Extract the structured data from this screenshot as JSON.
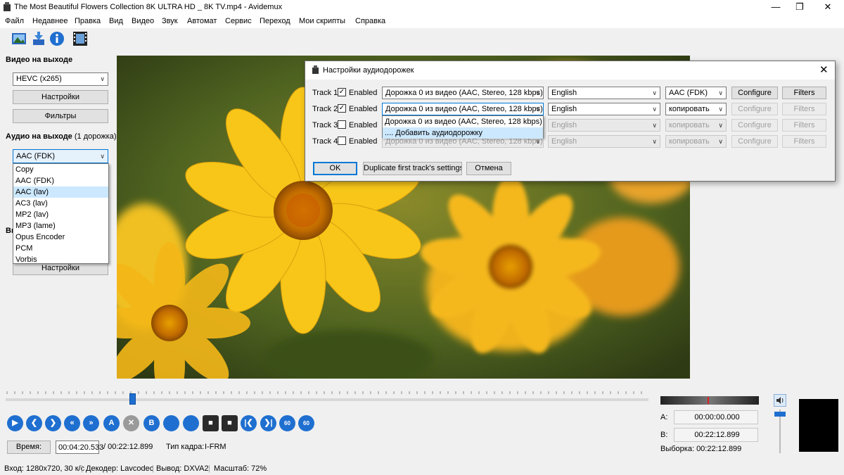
{
  "window": {
    "title": "The Most Beautiful Flowers Collection 8K ULTRA HD _ 8K TV.mp4 - Avidemux",
    "minimize_icon": "minimize-icon",
    "maximize_icon": "restore-icon",
    "close_icon": "close-icon"
  },
  "menu": [
    "Файл",
    "Недавнее",
    "Правка",
    "Вид",
    "Видео",
    "Звук",
    "Автомат",
    "Сервис",
    "Переход",
    "Мои скрипты",
    "Справка"
  ],
  "toolbar": {
    "icons": [
      "open-image-icon",
      "save-icon",
      "info-icon",
      "filmstrip-icon"
    ]
  },
  "left_panel": {
    "video_output_label": "Видео на выходе",
    "video_codec": "HEVC (x265)",
    "settings_label": "Настройки",
    "filters_label": "Фильтры",
    "audio_output_label": "Аудио на выходе",
    "audio_track_count": "(1 дорожка)",
    "audio_codec": "AAC (FDK)",
    "audio_codec_options": [
      "Copy",
      "AAC (FDK)",
      "AAC (lav)",
      "AC3 (lav)",
      "MP2 (lav)",
      "MP3 (lame)",
      "Opus Encoder",
      "PCM",
      "Vorbis"
    ],
    "audio_codec_highlighted": "AAC (lav)",
    "hidden_label_fragment": "Вь",
    "settings2_label": "Настройки"
  },
  "dialog": {
    "title": "Настройки аудиодорожек",
    "enabled_label": "Enabled",
    "tracks": [
      {
        "label": "Track 1",
        "enabled": true,
        "source": "Дорожка 0 из видео (AAC, Stereo, 128 kbps)",
        "language": "English",
        "codec": "AAC (FDK)",
        "configure": "Configure",
        "filters": "Filters",
        "active": true
      },
      {
        "label": "Track 2",
        "enabled": true,
        "source": "Дорожка 0 из видео (AAC, Stereo, 128 kbps)",
        "language": "English",
        "codec": "копировать",
        "configure": "Configure",
        "filters": "Filters",
        "active": false
      },
      {
        "label": "Track 3",
        "enabled": false,
        "source": "Дорожка 0 из видео (AAC, Stereo, 128 kbps)",
        "language": "English",
        "codec": "копировать",
        "configure": "Configure",
        "filters": "Filters",
        "active": false
      },
      {
        "label": "Track 4",
        "enabled": false,
        "source": "Дорожка 0 из видео (AAC, Stereo, 128 kbps)",
        "language": "English",
        "codec": "копировать",
        "configure": "Configure",
        "filters": "Filters",
        "active": false
      }
    ],
    "source_dropdown_options": [
      "Дорожка 0 из видео (AAC, Stereo, 128 kbps)",
      ".... Добавить аудиодорожку"
    ],
    "source_dropdown_highlighted": ".... Добавить аудиодорожку",
    "ok_label": "OK",
    "duplicate_label": "Duplicate first track's settings",
    "cancel_label": "Отмена"
  },
  "playback": {
    "slider_position": 0.197,
    "controls": [
      "play-icon",
      "rewind-icon",
      "forward-icon",
      "prev-frame-icon",
      "next-frame-icon",
      "set-marker-a-icon",
      "clear-markers-icon",
      "set-marker-b-icon",
      "prev-keyframe-icon",
      "next-keyframe-icon",
      "prev-black-icon",
      "next-black-icon",
      "go-start-icon",
      "go-end-icon",
      "back-60-icon",
      "forward-60-icon"
    ],
    "control_labels": [
      "",
      "",
      "",
      "",
      "",
      "A",
      "",
      "B",
      "",
      "",
      "",
      "",
      "",
      "",
      "60",
      "60"
    ],
    "time_button_label": "Время:",
    "current_time": "00:04:20.533",
    "total_time": "/ 00:22:12.899",
    "frame_type_label": "Тип кадра:",
    "frame_type": "I-FRM",
    "marker_a_label": "A:",
    "marker_a_value": "00:00:00.000",
    "marker_b_label": "B:",
    "marker_b_value": "00:22:12.899",
    "selection": "Выборка: 00:22:12.899",
    "volume_icon": "speaker-icon"
  },
  "statusbar": {
    "input": "Вход: 1280x720, 30 к/с",
    "decoder": "Декодер: Lavcodec",
    "output": "Вывод: DXVA2",
    "scale": "Масштаб: 72%"
  },
  "colors": {
    "accent": "#1f6fd0",
    "highlight": "#cce8ff",
    "video_bg": "#4a5a1e",
    "flower": "#f5c518"
  }
}
